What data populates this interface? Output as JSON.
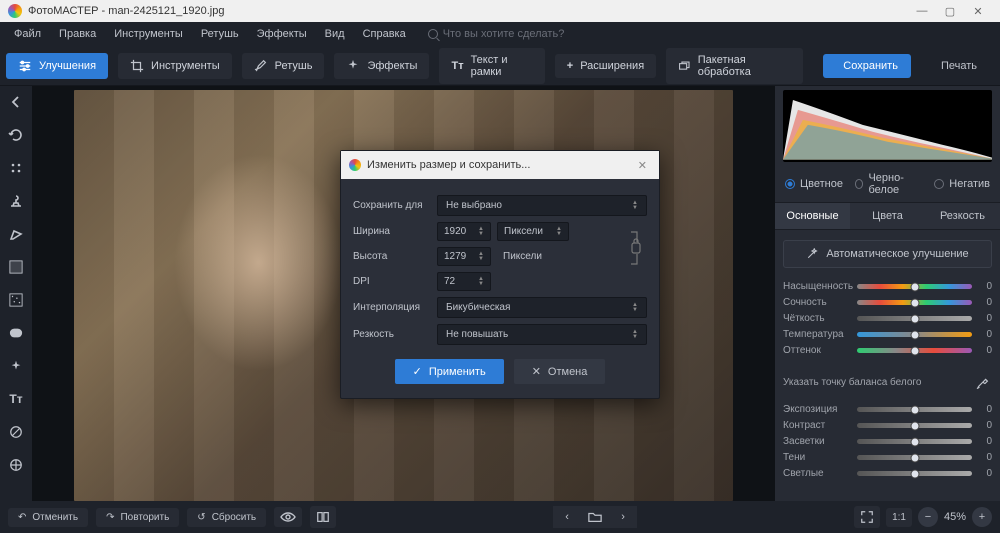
{
  "title": "ФотоМАСТЕР - man-2425121_1920.jpg",
  "menu": [
    "Файл",
    "Правка",
    "Инструменты",
    "Ретушь",
    "Эффекты",
    "Вид",
    "Справка"
  ],
  "search_placeholder": "Что вы хотите сделать?",
  "tabs": [
    {
      "label": "Улучшения"
    },
    {
      "label": "Инструменты"
    },
    {
      "label": "Ретушь"
    },
    {
      "label": "Эффекты"
    },
    {
      "label": "Текст и рамки"
    },
    {
      "label": "Расширения"
    },
    {
      "label": "Пакетная обработка"
    }
  ],
  "save_btn": "Сохранить",
  "print_btn": "Печать",
  "radio": {
    "color": "Цветное",
    "bw": "Черно-белое",
    "neg": "Негатив"
  },
  "subtabs": [
    "Основные",
    "Цвета",
    "Резкость"
  ],
  "auto_btn": "Автоматическое улучшение",
  "sliders": [
    {
      "label": "Насыщенность",
      "type": "sat",
      "val": "0"
    },
    {
      "label": "Сочность",
      "type": "sat",
      "val": "0"
    },
    {
      "label": "Чёткость",
      "type": "gray",
      "val": "0"
    },
    {
      "label": "Температура",
      "type": "temp",
      "val": "0"
    },
    {
      "label": "Оттенок",
      "type": "tint",
      "val": "0"
    }
  ],
  "wb_label": "Указать точку баланса белого",
  "sliders2": [
    {
      "label": "Экспозиция",
      "type": "gray",
      "val": "0"
    },
    {
      "label": "Контраст",
      "type": "gray",
      "val": "0"
    },
    {
      "label": "Засветки",
      "type": "gray",
      "val": "0"
    },
    {
      "label": "Тени",
      "type": "gray",
      "val": "0"
    },
    {
      "label": "Светлые",
      "type": "gray",
      "val": "0"
    }
  ],
  "bottom": {
    "undo": "Отменить",
    "redo": "Повторить",
    "reset": "Сбросить",
    "zoom": "45%",
    "ratio": "1:1"
  },
  "dialog": {
    "title": "Изменить размер и сохранить...",
    "save_for": "Сохранить для",
    "save_for_val": "Не выбрано",
    "width": "Ширина",
    "width_val": "1920",
    "height": "Высота",
    "height_val": "1279",
    "dpi": "DPI",
    "dpi_val": "72",
    "unit": "Пиксели",
    "interp": "Интерполяция",
    "interp_val": "Бикубическая",
    "sharp": "Резкость",
    "sharp_val": "Не повышать",
    "apply": "Применить",
    "cancel": "Отмена"
  }
}
